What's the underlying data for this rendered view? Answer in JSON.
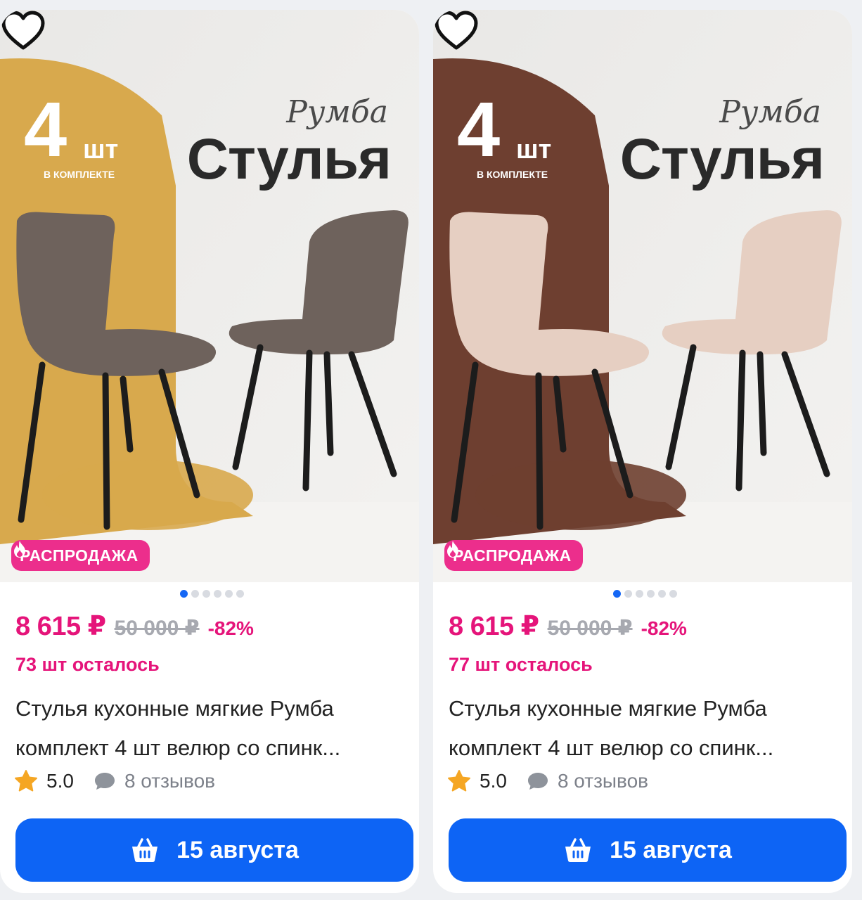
{
  "products": [
    {
      "image": {
        "quantity_number": "4",
        "quantity_unit": "шт",
        "quantity_caption": "В КОМПЛЕКТЕ",
        "brand_script": "Румба",
        "brand_title": "Стулья",
        "chair_color": "#6e625c",
        "arch_color": "#d8a94d"
      },
      "badge": "РАСПРОДАЖА",
      "price": "8 615 ₽",
      "old_price": "50 000 ₽",
      "discount": "-82%",
      "stock": "73 шт осталось",
      "title_line1": "Стулья кухонные мягкие Румба",
      "title_line2": "комплект 4 шт велюр со спинк...",
      "rating": "5.0",
      "reviews": "8 отзывов",
      "delivery_button": "15 августа",
      "carousel_active_index": 0
    },
    {
      "image": {
        "quantity_number": "4",
        "quantity_unit": "шт",
        "quantity_caption": "В КОМПЛЕКТЕ",
        "brand_script": "Румба",
        "brand_title": "Стулья",
        "chair_color": "#e6cfc2",
        "arch_color": "#6e3f30"
      },
      "badge": "РАСПРОДАЖА",
      "price": "8 615 ₽",
      "old_price": "50 000 ₽",
      "discount": "-82%",
      "stock": "77 шт осталось",
      "title_line1": "Стулья кухонные мягкие Румба",
      "title_line2": "комплект 4 шт велюр со спинк...",
      "rating": "5.0",
      "reviews": "8 отзывов",
      "delivery_button": "15 августа",
      "carousel_active_index": 0
    }
  ],
  "colors": {
    "accent_pink": "#e5147a",
    "button_blue": "#0d64f5",
    "badge_pink": "#ec2e8c",
    "star_yellow": "#f5a623"
  },
  "icons": {
    "favorite": "heart-outline-icon",
    "badge": "fire-icon",
    "rating": "star-icon",
    "reviews": "chat-bubble-icon",
    "cart": "basket-icon"
  }
}
